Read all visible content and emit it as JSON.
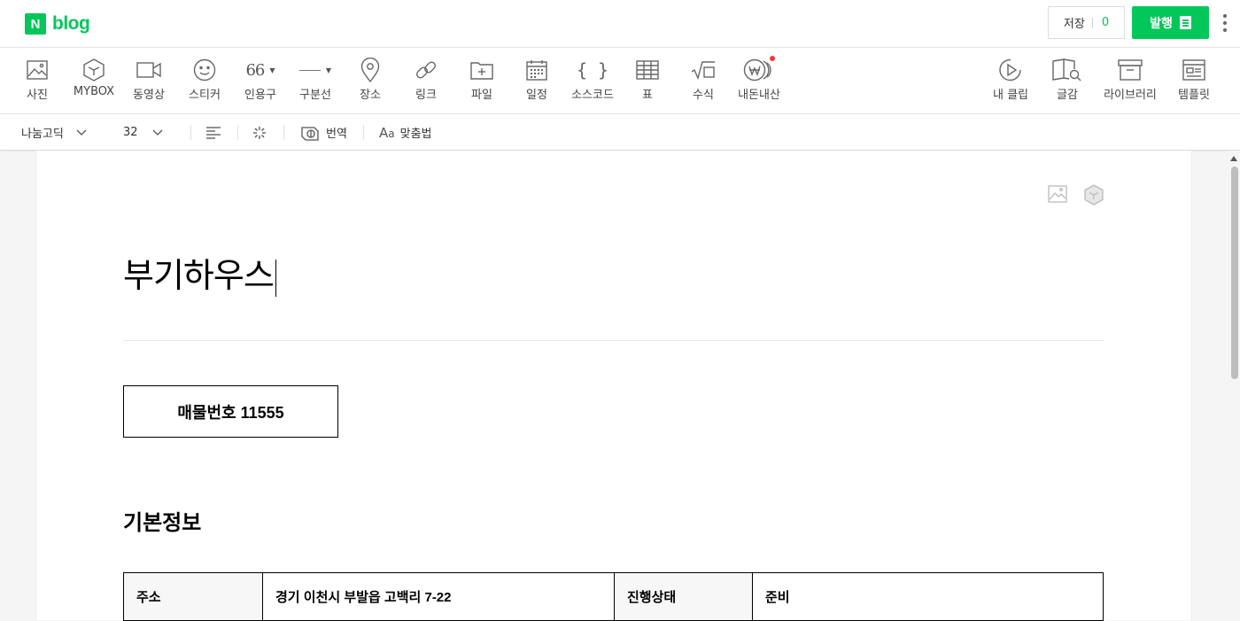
{
  "header": {
    "logo_n": "N",
    "logo_text": "blog",
    "save_label": "저장",
    "save_count": "0",
    "publish_label": "발행"
  },
  "toolbar": {
    "items": [
      {
        "label": "사진",
        "icon": "photo-icon"
      },
      {
        "label": "MYBOX",
        "icon": "mybox-icon"
      },
      {
        "label": "동영상",
        "icon": "video-icon"
      },
      {
        "label": "스티커",
        "icon": "sticker-icon"
      },
      {
        "label": "인용구",
        "icon": "quote-icon"
      },
      {
        "label": "구분선",
        "icon": "divider-icon"
      },
      {
        "label": "장소",
        "icon": "location-pin-icon"
      },
      {
        "label": "링크",
        "icon": "link-icon"
      },
      {
        "label": "파일",
        "icon": "file-icon"
      },
      {
        "label": "일정",
        "icon": "calendar-icon"
      },
      {
        "label": "소스코드",
        "icon": "code-braces-icon"
      },
      {
        "label": "표",
        "icon": "table-icon"
      },
      {
        "label": "수식",
        "icon": "formula-icon"
      },
      {
        "label": "내돈내산",
        "icon": "won-coin-icon"
      }
    ],
    "right_items": [
      {
        "label": "내 클립",
        "icon": "clip-play-icon"
      },
      {
        "label": "글감",
        "icon": "book-search-icon"
      },
      {
        "label": "라이브러리",
        "icon": "archive-box-icon"
      },
      {
        "label": "템플릿",
        "icon": "template-icon"
      }
    ]
  },
  "format_bar": {
    "font": "나눔고딕",
    "size": "32",
    "translate_label": "번역",
    "spellcheck_label": "맞춤법"
  },
  "document": {
    "title": "부기하우스",
    "item_number": "매물번호 11555",
    "section_title": "기본정보",
    "table": {
      "rows": [
        [
          "주소",
          "경기 이천시 부발읍 고백리 7-22",
          "진행상태",
          "준비"
        ]
      ]
    }
  },
  "colors": {
    "brand_green": "#03c75a",
    "notification_dot": "#ff3333"
  }
}
